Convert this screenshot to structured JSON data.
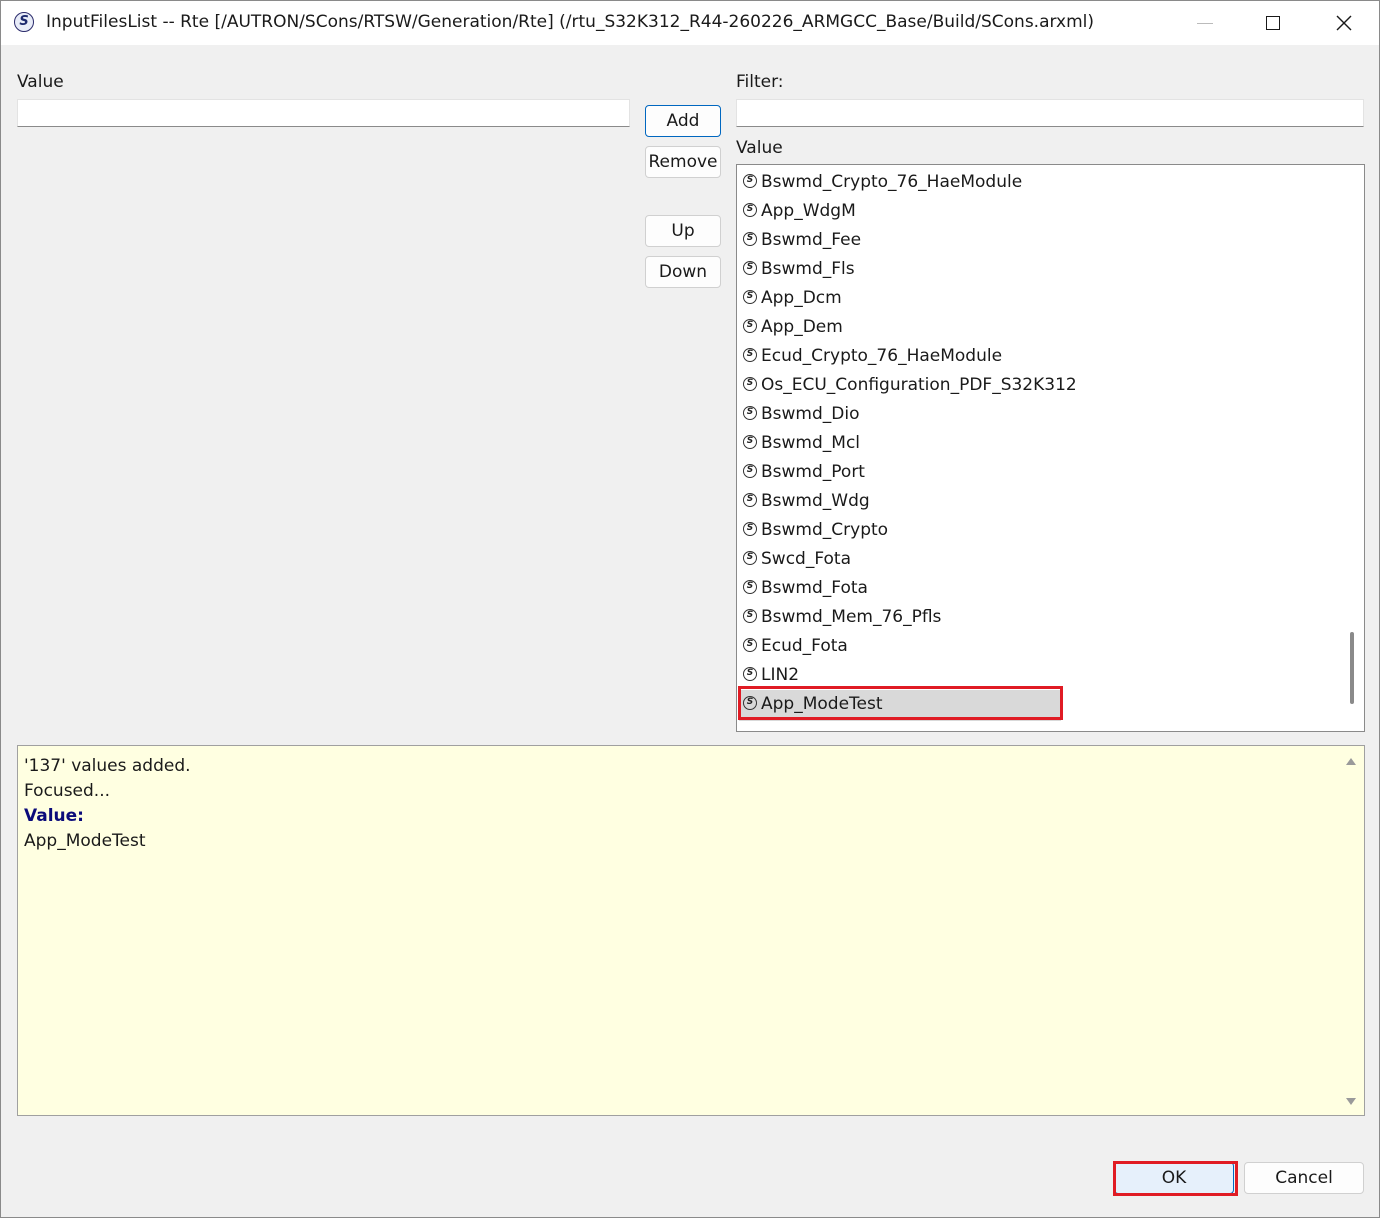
{
  "window": {
    "title": "InputFilesList -- Rte [/AUTRON/SCons/RTSW/Generation/Rte] (/rtu_S32K312_R44-260226_ARMGCC_Base/Build/SCons.arxml)",
    "app_icon_glyph": "S"
  },
  "left": {
    "value_label": "Value",
    "value_input": ""
  },
  "buttons": {
    "add": "Add",
    "remove": "Remove",
    "up": "Up",
    "down": "Down"
  },
  "right": {
    "filter_label": "Filter:",
    "filter_input": "",
    "list_label": "Value",
    "items": [
      "Bswmd_Crypto_76_HaeModule",
      "App_WdgM",
      "Bswmd_Fee",
      "Bswmd_Fls",
      "App_Dcm",
      "App_Dem",
      "Ecud_Crypto_76_HaeModule",
      "Os_ECU_Configuration_PDF_S32K312",
      "Bswmd_Dio",
      "Bswmd_Mcl",
      "Bswmd_Port",
      "Bswmd_Wdg",
      "Bswmd_Crypto",
      "Swcd_Fota",
      "Bswmd_Fota",
      "Bswmd_Mem_76_Pfls",
      "Ecud_Fota",
      "LIN2",
      "App_ModeTest"
    ],
    "selected_item": "App_ModeTest",
    "item_icon": "sym-icon"
  },
  "info": {
    "line1": "'137' values added.",
    "line2": "Focused...",
    "line3": "Value:",
    "line4": "App_ModeTest"
  },
  "footer": {
    "ok": "OK",
    "cancel": "Cancel"
  },
  "colors": {
    "highlight_red": "#e01b24",
    "info_bg": "#ffffe1",
    "accent": "#0067c0"
  }
}
